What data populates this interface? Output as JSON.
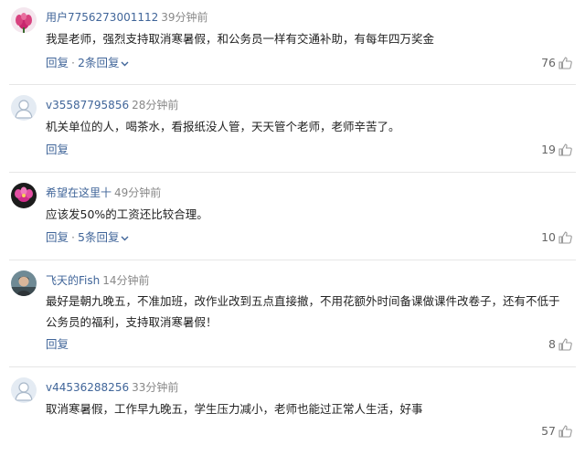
{
  "comments": [
    {
      "username": "用户7756273001112",
      "time": "39分钟前",
      "text": "我是老师，强烈支持取消寒暑假，和公务员一样有交通补助，有每年四万奖金",
      "reply_label": "回复",
      "separator": "·",
      "replies_label": "2条回复",
      "likes": "76",
      "avatar": "flower-pink"
    },
    {
      "username": "v35587795856",
      "time": "28分钟前",
      "text": "机关单位的人，喝茶水，看报纸没人管，天天管个老师，老师辛苦了。",
      "reply_label": "回复",
      "likes": "19",
      "avatar": "default-user"
    },
    {
      "username": "希望在这里十",
      "time": "49分钟前",
      "text": "应该发50%的工资还比较合理。",
      "reply_label": "回复",
      "separator": "·",
      "replies_label": "5条回复",
      "likes": "10",
      "avatar": "flower-magenta"
    },
    {
      "username": "飞天的Fish",
      "time": "14分钟前",
      "text": "最好是朝九晚五，不准加班，改作业改到五点直接撤，不用花额外时间备课做课件改卷子，还有不低于公务员的福利，支持取消寒暑假！",
      "reply_label": "回复",
      "likes": "8",
      "avatar": "photo-person"
    },
    {
      "username": "v44536288256",
      "time": "33分钟前",
      "text": "取消寒暑假，工作早九晚五，学生压力减小，老师也能过正常人生活，好事",
      "reply_label": "回复",
      "likes": "57",
      "avatar": "default-user"
    }
  ],
  "colors": {
    "username": "#406599",
    "time": "#888888",
    "text": "#222222",
    "action": "#406599",
    "divider": "#e6e6e6"
  }
}
